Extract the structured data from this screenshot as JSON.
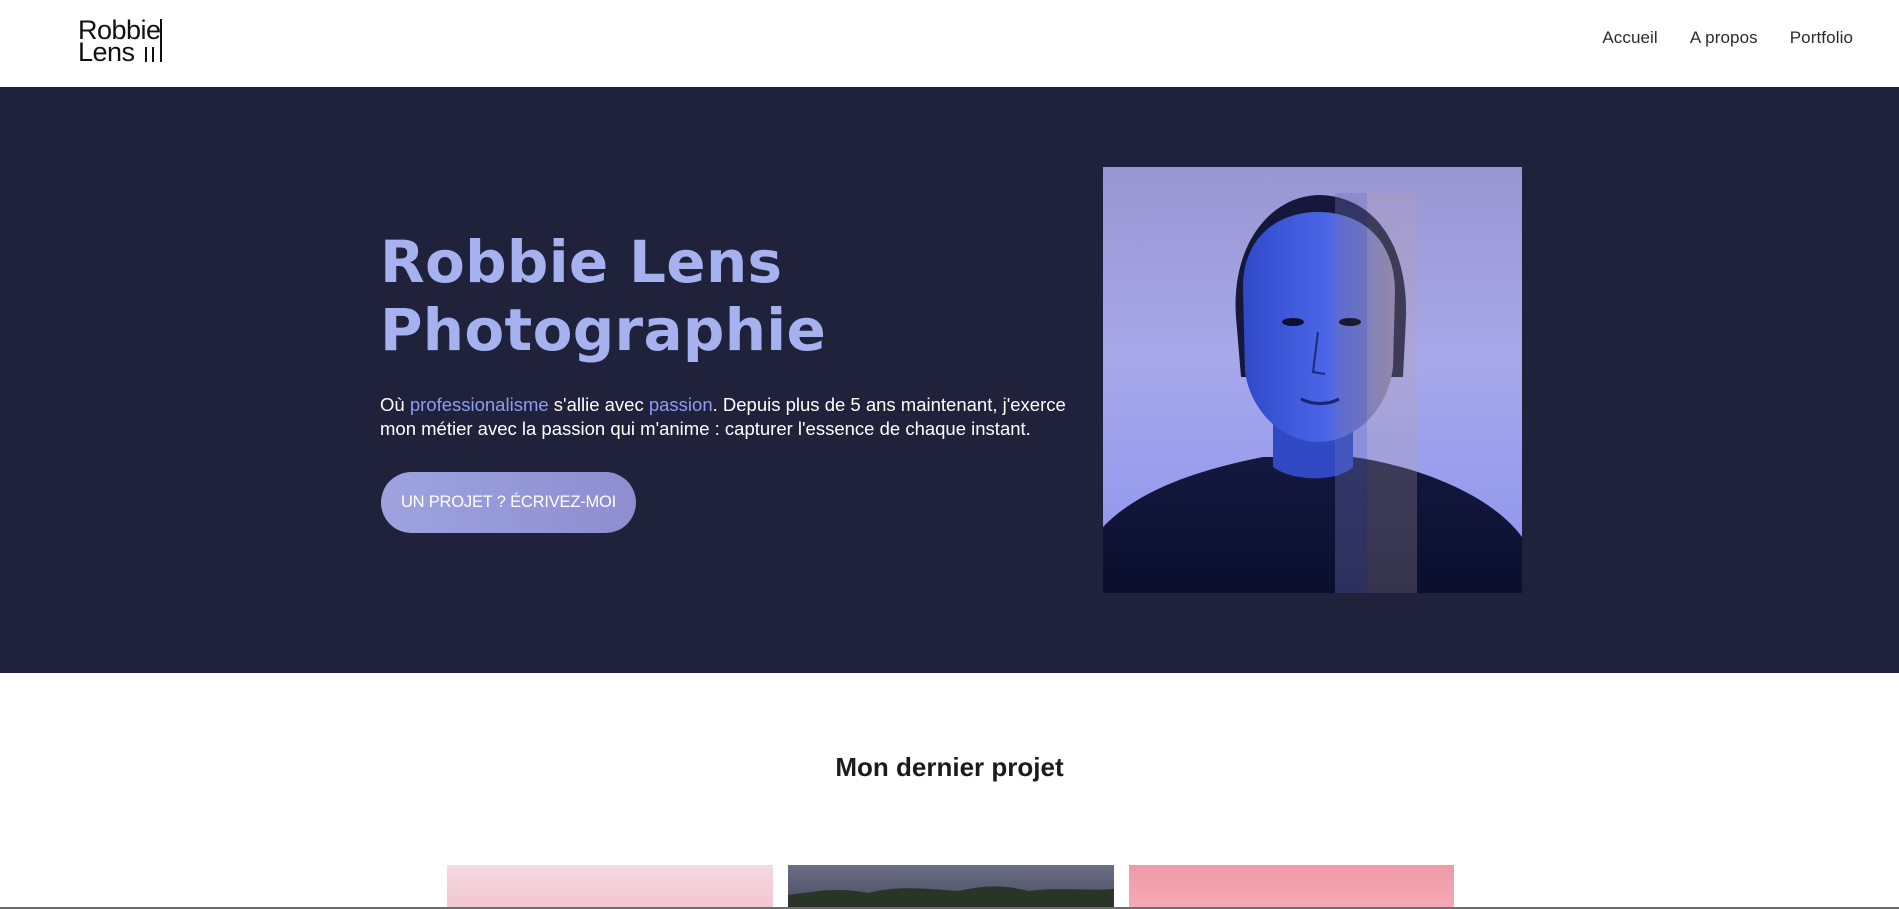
{
  "header": {
    "logo": {
      "line1": "Robbie",
      "line2": "Lens"
    },
    "nav": [
      {
        "label": "Accueil"
      },
      {
        "label": "A propos"
      },
      {
        "label": "Portfolio"
      }
    ]
  },
  "hero": {
    "title_line1": "Robbie Lens",
    "title_line2": "Photographie",
    "text": {
      "part1": "Où ",
      "highlight1": "professionalisme",
      "part2": " s'allie avec ",
      "highlight2": "passion",
      "part3": ". Depuis plus de 5 ans maintenant, j'exerce mon métier avec la passion qui m'anime : capturer l'essence de chaque instant."
    },
    "cta_label": "UN PROJET ? ÉCRIVEZ-MOI"
  },
  "project": {
    "title": "Mon dernier projet"
  },
  "colors": {
    "hero_bg": "#20213b",
    "accent": "#a6b1ef",
    "highlight": "#8f9bf2",
    "cta": "#9ea3df"
  }
}
